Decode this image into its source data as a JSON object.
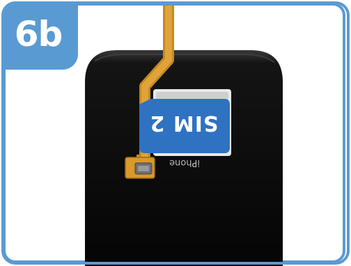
{
  "step": {
    "label": "6b"
  },
  "sim_card": {
    "label": "SIM 2"
  },
  "phone": {
    "brand": "iPhone"
  },
  "colors": {
    "accent": "#5a9ad3",
    "sim_blue": "#2f72c2",
    "flex_cable": "#d99a2a",
    "phone_body": "#0d0d0d"
  },
  "icons": [
    "flex-cable-icon",
    "sim-card-icon",
    "phone-icon"
  ]
}
